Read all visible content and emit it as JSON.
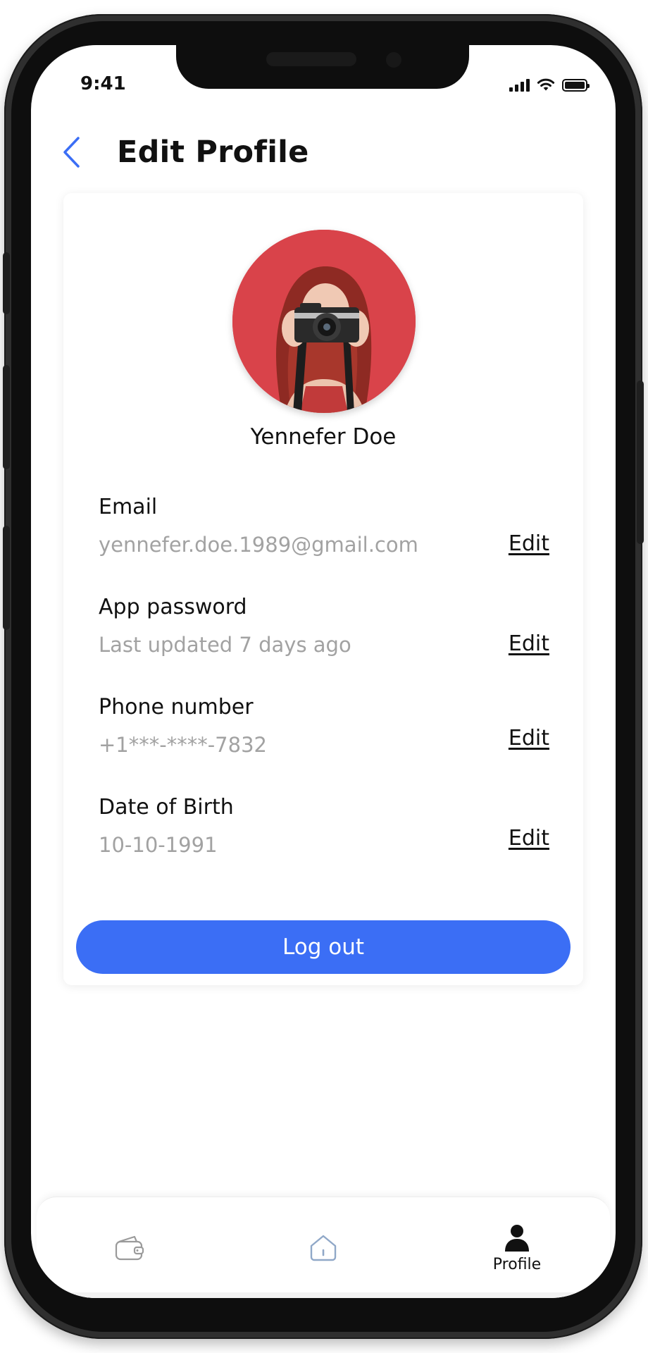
{
  "status_bar": {
    "time": "9:41",
    "icons": [
      "signal-icon",
      "wifi-icon",
      "battery-icon"
    ]
  },
  "header": {
    "back_icon": "chevron-left-icon",
    "title": "Edit Profile"
  },
  "profile": {
    "avatar": "avatar-photo",
    "name": "Yennefer Doe"
  },
  "fields": [
    {
      "label": "Email",
      "value": "yennefer.doe.1989@gmail.com",
      "action": "Edit"
    },
    {
      "label": "App password",
      "value": "Last updated 7 days ago",
      "action": "Edit"
    },
    {
      "label": "Phone number",
      "value": "+1***-****-7832",
      "action": "Edit"
    },
    {
      "label": "Date of Birth",
      "value": "10-10-1991",
      "action": "Edit"
    }
  ],
  "logout_label": "Log out",
  "bottom_nav": {
    "items": [
      {
        "icon": "wallet-icon",
        "active": false
      },
      {
        "icon": "home-icon",
        "active": false
      },
      {
        "icon": "person-icon",
        "label": "Profile",
        "active": true
      }
    ]
  },
  "colors": {
    "accent": "#3b6ef5",
    "secondary_text": "#a2a2a2",
    "avatar_background": "#d9434a"
  }
}
